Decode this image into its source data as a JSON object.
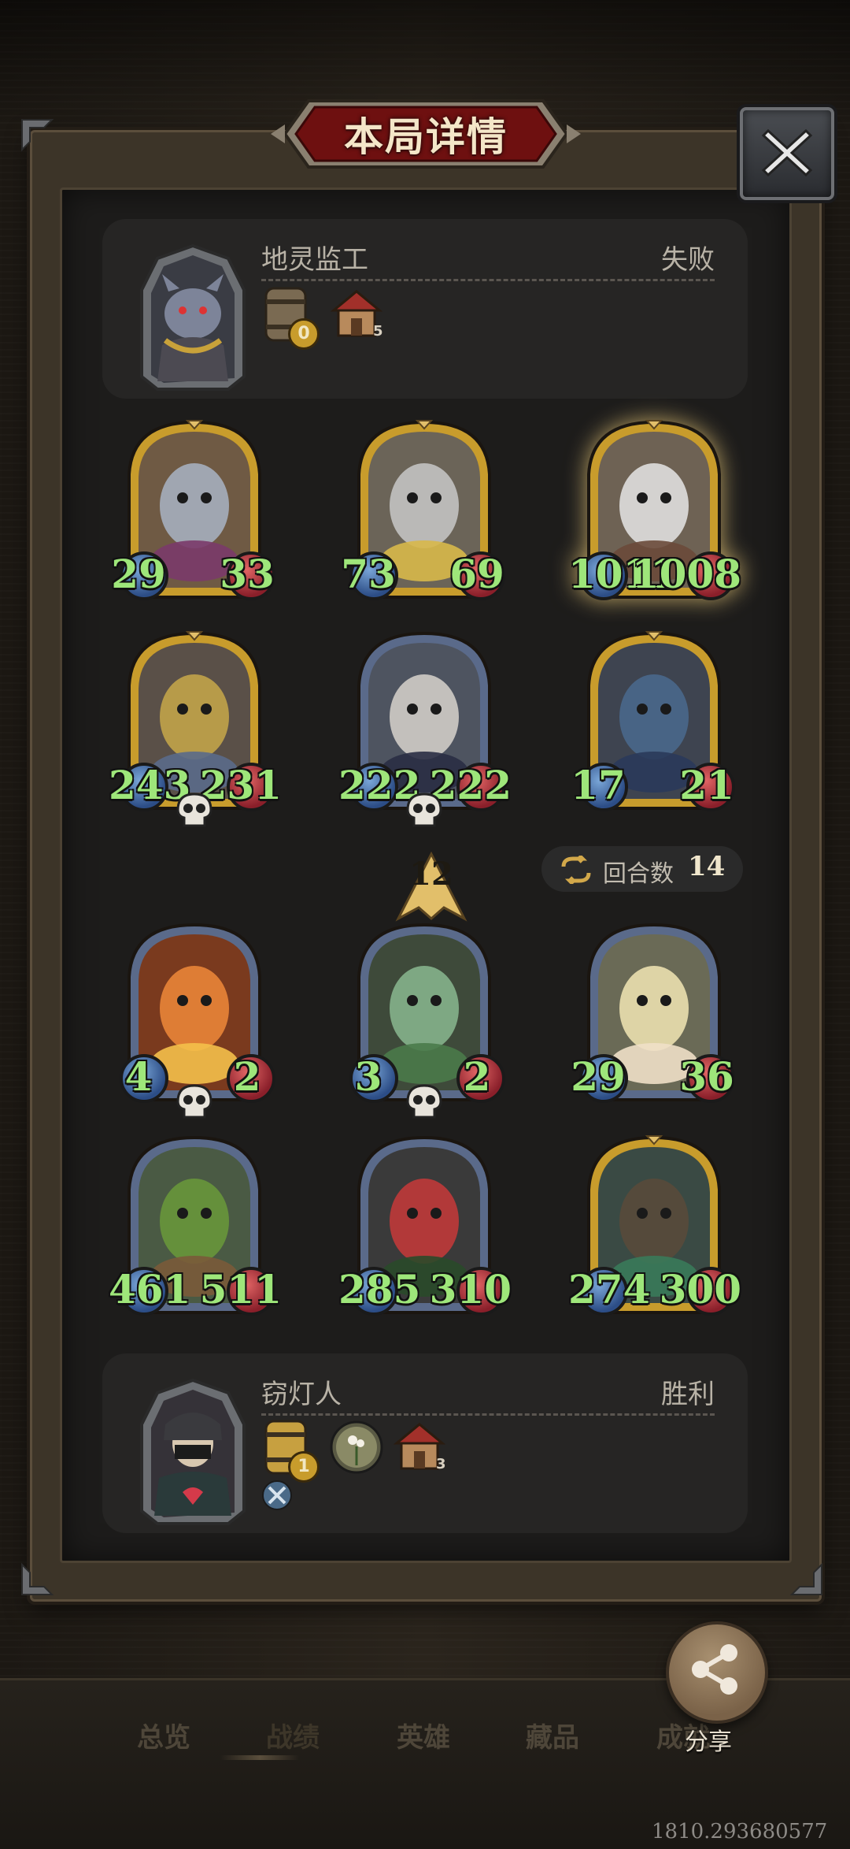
{
  "title": "本局详情",
  "opponent": {
    "name": "地灵监工",
    "result": "失败",
    "token_gold": "0",
    "house_level": "5"
  },
  "player": {
    "name": "窃灯人",
    "result": "胜利",
    "token_gold": "1",
    "house_level": "3"
  },
  "opponent_cards": [
    {
      "attack": "29",
      "health": "33",
      "frame": "gold",
      "skull": false
    },
    {
      "attack": "73",
      "health": "69",
      "frame": "gold",
      "skull": false
    },
    {
      "attack": "1011",
      "health": "1008",
      "frame": "gold-glow",
      "skull": false
    },
    {
      "attack": "243",
      "health": "231",
      "frame": "gold",
      "skull": true
    },
    {
      "attack": "222",
      "health": "222",
      "frame": "silver",
      "skull": true
    },
    {
      "attack": "17",
      "health": "21",
      "frame": "gold",
      "skull": false
    }
  ],
  "player_cards": [
    {
      "attack": "4",
      "health": "2",
      "frame": "silver",
      "skull": true
    },
    {
      "attack": "3",
      "health": "2",
      "frame": "silver",
      "skull": true
    },
    {
      "attack": "29",
      "health": "36",
      "frame": "silver",
      "skull": false
    },
    {
      "attack": "461",
      "health": "511",
      "frame": "silver",
      "skull": false
    },
    {
      "attack": "285",
      "health": "310",
      "frame": "silver",
      "skull": false
    },
    {
      "attack": "274",
      "health": "300",
      "frame": "gold",
      "skull": false
    }
  ],
  "level_badge": "12",
  "rounds": {
    "label": "回合数",
    "value": "14"
  },
  "nav": [
    "总览",
    "战绩",
    "英雄",
    "藏品",
    "成就"
  ],
  "nav_active": "战绩",
  "share_label": "分享",
  "coords": "1810.293680577",
  "colors": {
    "stat_green": "#9ee67a",
    "title_red": "#7a1515",
    "frame_gold": "#c89c2c",
    "frame_silver": "#5a6a8a"
  }
}
